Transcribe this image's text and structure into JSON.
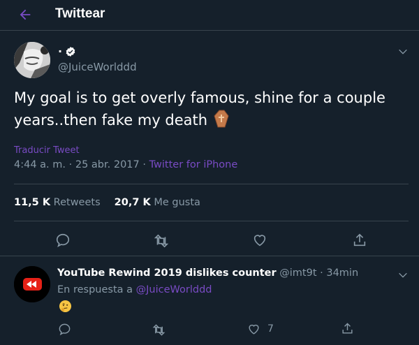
{
  "header": {
    "title": "Twittear",
    "back_icon": "arrow-left-icon"
  },
  "tweet": {
    "display_name": ".",
    "handle": "@JuiceWorlddd",
    "verified": true,
    "text": "My goal is to get overly famous, shine for a couple years..then fake my death",
    "emoji": "coffin-emoji",
    "translate_label": "Traducir Tweet",
    "time": "4:44 a. m.",
    "separator": " · ",
    "date": "25 abr. 2017",
    "source": "Twitter for iPhone",
    "retweets_count": "11,5 K",
    "retweets_label": "Retweets",
    "likes_count": "20,7 K",
    "likes_label": "Me gusta"
  },
  "reply": {
    "name": "YouTube Rewind 2019 dislikes counter",
    "handle": "@imt9t",
    "separator": " · ",
    "time": "34min",
    "context_prefix": "En respuesta a",
    "context_mention": "@JuiceWorlddd",
    "emoji": "thinking-face-emoji",
    "like_count": "7"
  },
  "colors": {
    "background": "#15202b",
    "accent": "#794bc4",
    "secondary_text": "#8899a6",
    "divider": "#38444d"
  }
}
